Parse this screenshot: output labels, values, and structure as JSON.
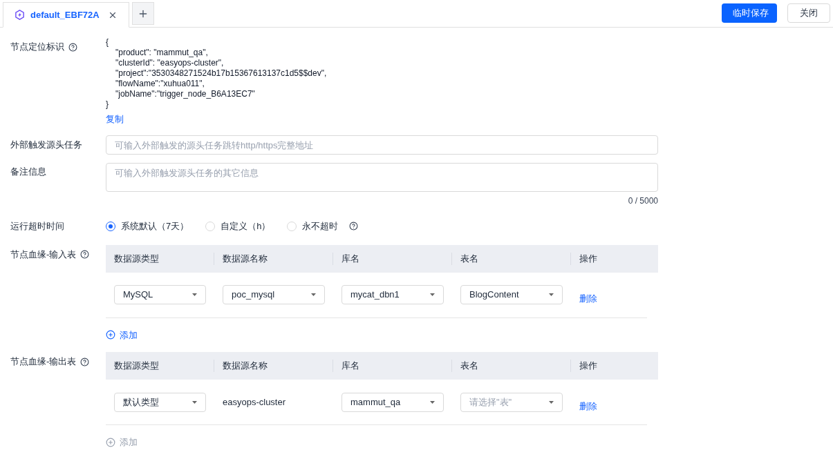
{
  "tabs": [
    {
      "label": "default_EBF72A",
      "selected": true
    }
  ],
  "buttons": [
    {
      "label": "临时保存",
      "kind": "primary"
    },
    {
      "label": "关闭",
      "kind": "default"
    }
  ],
  "node_id": {
    "label": "节点定位标识",
    "code": [
      "{",
      "\"product\": \"mammut_qa\",",
      "\"clusterId\": \"easyops-cluster\",",
      "\"project\":\"3530348271524b17b15367613137c1d5$$dev\",",
      "\"flowName\":\"xuhua011\",",
      "\"jobName\":\"trigger_node_B6A13EC7\"",
      "}"
    ],
    "copy": "复制"
  },
  "external_task": {
    "label": "外部触发源头任务",
    "placeholder": "可输入外部触发的源头任务跳转http/https完整地址"
  },
  "notes": {
    "label": "备注信息",
    "placeholder": "可输入外部触发源头任务的其它信息",
    "counter": "0 / 5000"
  },
  "timeout": {
    "label": "运行超时时间",
    "options": [
      {
        "label": "系统默认（7天）",
        "selected": true
      },
      {
        "label": "自定义（h）",
        "selected": false
      },
      {
        "label": "永不超时",
        "selected": false
      }
    ]
  },
  "lineage": [
    {
      "label": "节点血缘-输入表",
      "columns": [
        "数据源类型",
        "数据源名称",
        "库名",
        "表名",
        "操作"
      ],
      "rows": [
        {
          "cells": [
            {
              "kind": "select",
              "value": "MySQL"
            },
            {
              "kind": "select",
              "value": "poc_mysql"
            },
            {
              "kind": "select",
              "value": "mycat_dbn1"
            },
            {
              "kind": "select",
              "value": "BlogContent"
            }
          ],
          "action": "删除"
        }
      ],
      "add": {
        "label": "添加",
        "disabled": false
      }
    },
    {
      "label": "节点血缘-输出表",
      "columns": [
        "数据源类型",
        "数据源名称",
        "库名",
        "表名",
        "操作"
      ],
      "rows": [
        {
          "cells": [
            {
              "kind": "select",
              "value": "默认类型"
            },
            {
              "kind": "text",
              "value": "easyops-cluster"
            },
            {
              "kind": "select",
              "value": "mammut_qa"
            },
            {
              "kind": "select",
              "placeholder": "请选择\"表\""
            }
          ],
          "action": "删除"
        }
      ],
      "add": {
        "label": "添加",
        "disabled": true
      }
    }
  ]
}
